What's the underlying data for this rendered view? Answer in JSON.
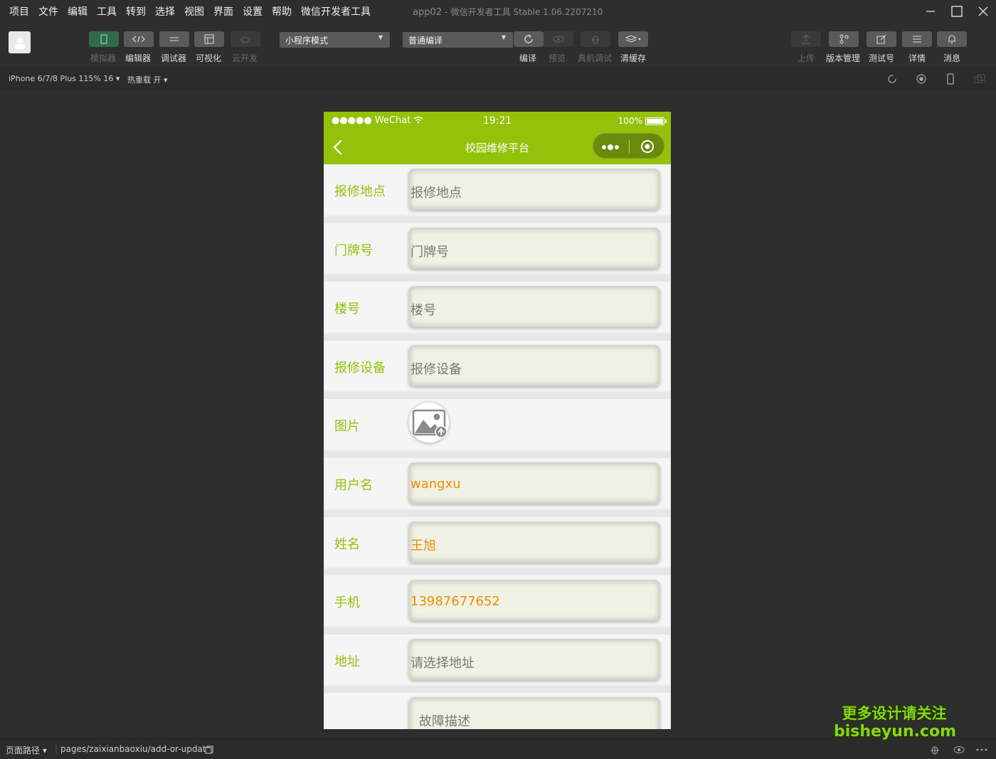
{
  "menu": [
    "项目",
    "文件",
    "编辑",
    "工具",
    "转到",
    "选择",
    "视图",
    "界面",
    "设置",
    "帮助",
    "微信开发者工具"
  ],
  "window": {
    "app_name": "app02",
    "separator": "-",
    "tool_name": "微信开发者工具 Stable 1.06.2207210"
  },
  "toolbar": {
    "simulator": "模拟器",
    "editor": "编辑器",
    "debugger": "调试器",
    "visual": "可视化",
    "cloud": "云开发",
    "mode_select": "小程序模式",
    "compile_select": "普通编译",
    "compile": "编译",
    "preview": "预览",
    "real_debug": "真机调试",
    "clear_cache": "清缓存",
    "upload": "上传",
    "version": "版本管理",
    "test": "测试号",
    "details": "详情",
    "messages": "消息"
  },
  "devicebar": {
    "device": "iPhone 6/7/8 Plus 115% 16 ▾",
    "hot_reload": "热重载 开 ▾"
  },
  "phone": {
    "signal": "●●●●● WeChat",
    "time": "19:21",
    "battery": "100%",
    "title": "校园维修平台"
  },
  "form": {
    "rows": [
      {
        "label": "报修地点",
        "value": "报修地点",
        "filled": false
      },
      {
        "label": "门牌号",
        "value": "门牌号",
        "filled": false
      },
      {
        "label": "楼号",
        "value": "楼号",
        "filled": false
      },
      {
        "label": "报修设备",
        "value": "报修设备",
        "filled": false
      },
      {
        "label": "图片",
        "value": "",
        "filled": false
      },
      {
        "label": "用户名",
        "value": "wangxu",
        "filled": true
      },
      {
        "label": "姓名",
        "value": "王旭",
        "filled": true
      },
      {
        "label": "手机",
        "value": "13987677652",
        "filled": true
      },
      {
        "label": "地址",
        "value": "请选择地址",
        "filled": false
      },
      {
        "label": "",
        "value": "故障描述",
        "filled": false
      }
    ]
  },
  "bottombar": {
    "path_label": "页面路径 ▾",
    "path": "pages/zaixianbaoxiu/add-or-update"
  },
  "watermark": {
    "line1": "更多设计请关注",
    "line2": "bisheyun.com"
  },
  "colors": {
    "brand_green": "#94c10a",
    "value_orange": "#f08c00",
    "ide_bg": "#2e2e2e"
  }
}
